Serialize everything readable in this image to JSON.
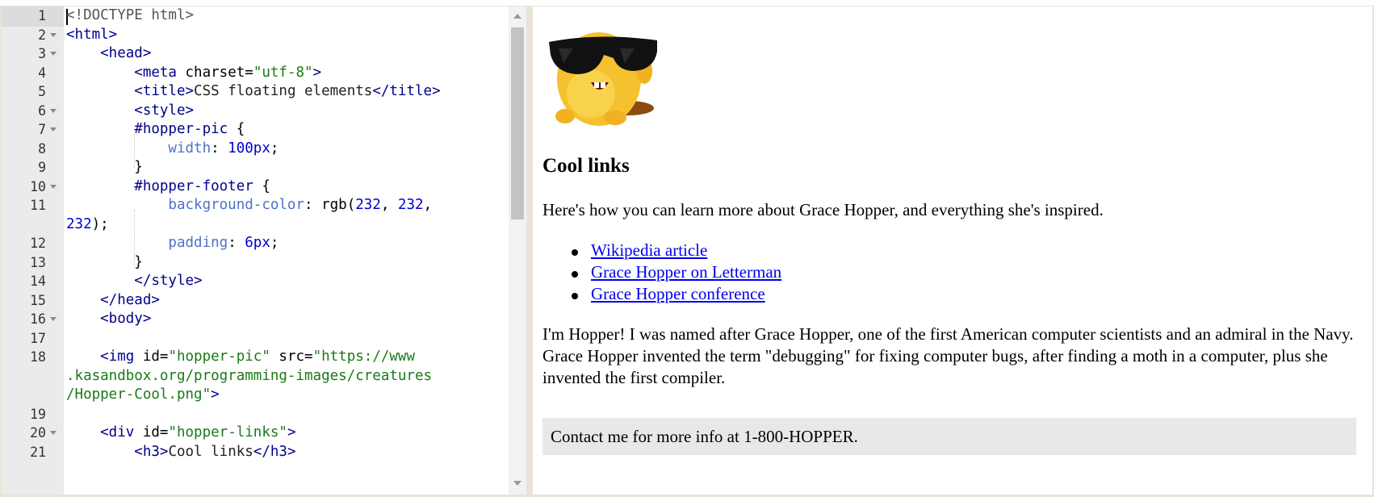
{
  "editor": {
    "line_numbers": [
      "1",
      "2",
      "3",
      "4",
      "5",
      "6",
      "7",
      "8",
      "9",
      "10",
      "11",
      "",
      "12",
      "13",
      "14",
      "15",
      "16",
      "17",
      "18",
      "",
      "",
      "19",
      "20",
      "21"
    ],
    "lines": [
      [
        [
          "t-doc",
          "<!DOCTYPE html>"
        ]
      ],
      [
        [
          "t-tag",
          "<html>"
        ]
      ],
      [
        [
          "t-tag",
          "    <head>"
        ]
      ],
      [
        [
          "t-tag",
          "        <meta "
        ],
        [
          "t-attr",
          "charset="
        ],
        [
          "t-str",
          "\"utf-8\""
        ],
        [
          "t-tag",
          ">"
        ]
      ],
      [
        [
          "t-tag",
          "        <title>"
        ],
        [
          "t-txt",
          "CSS floating elements"
        ],
        [
          "t-tag",
          "</title>"
        ]
      ],
      [
        [
          "t-tag",
          "        <style>"
        ]
      ],
      [
        [
          "t-sel",
          "        #hopper-pic"
        ],
        [
          "t-punc",
          " {"
        ]
      ],
      [
        [
          "t-prop",
          "            width"
        ],
        [
          "t-punc",
          ": "
        ],
        [
          "t-num",
          "100px"
        ],
        [
          "t-punc",
          ";"
        ]
      ],
      [
        [
          "t-punc",
          "        }"
        ]
      ],
      [
        [
          "t-sel",
          "        #hopper-footer"
        ],
        [
          "t-punc",
          " {"
        ]
      ],
      [
        [
          "t-prop",
          "            background-color"
        ],
        [
          "t-punc",
          ": rgb("
        ],
        [
          "t-num",
          "232"
        ],
        [
          "t-punc",
          ", "
        ],
        [
          "t-num",
          "232"
        ],
        [
          "t-punc",
          ","
        ]
      ],
      [
        [
          "t-num",
          "232"
        ],
        [
          "t-punc",
          ");"
        ]
      ],
      [
        [
          "t-prop",
          "            padding"
        ],
        [
          "t-punc",
          ": "
        ],
        [
          "t-num",
          "6px"
        ],
        [
          "t-punc",
          ";"
        ]
      ],
      [
        [
          "t-punc",
          "        }"
        ]
      ],
      [
        [
          "t-tag",
          "        </style>"
        ]
      ],
      [
        [
          "t-tag",
          "    </head>"
        ]
      ],
      [
        [
          "t-tag",
          "    <body>"
        ]
      ],
      [],
      [
        [
          "t-tag",
          "    <img "
        ],
        [
          "t-attr",
          "id="
        ],
        [
          "t-str",
          "\"hopper-pic\""
        ],
        [
          "t-attr",
          " src="
        ],
        [
          "t-str",
          "\"https://www"
        ]
      ],
      [
        [
          "t-str",
          ".kasandbox.org/programming-images/creatures"
        ]
      ],
      [
        [
          "t-str",
          "/Hopper-Cool.png\""
        ],
        [
          "t-tag",
          ">"
        ]
      ],
      [],
      [
        [
          "t-tag",
          "    <div "
        ],
        [
          "t-attr",
          "id="
        ],
        [
          "t-str",
          "\"hopper-links\""
        ],
        [
          "t-tag",
          ">"
        ]
      ],
      [
        [
          "t-tag",
          "        <h3>"
        ],
        [
          "t-txt",
          "Cool links"
        ],
        [
          "t-tag",
          "</h3>"
        ]
      ]
    ],
    "fold_markers": [
      "2",
      "3",
      "6",
      "7",
      "10",
      "16",
      "20"
    ]
  },
  "preview": {
    "image_alt": "Hopper-Cool",
    "heading": "Cool links",
    "intro": "Here's how you can learn more about Grace Hopper, and everything she's inspired.",
    "links": [
      "Wikipedia article",
      "Grace Hopper on Letterman",
      "Grace Hopper conference"
    ],
    "bio": "I'm Hopper! I was named after Grace Hopper, one of the first American computer scientists and an admiral in the Navy. Grace Hopper invented the term \"debugging\" for fixing computer bugs, after finding a moth in a computer, plus she invented the first compiler.",
    "footer": "Contact me for more info at 1-800-HOPPER."
  },
  "colors": {
    "footer_bg": "#e8e8e8",
    "link": "#0000ee",
    "tag": "#00008b",
    "string": "#1a7a14",
    "property": "#4e72c9",
    "number": "#0000cd"
  }
}
